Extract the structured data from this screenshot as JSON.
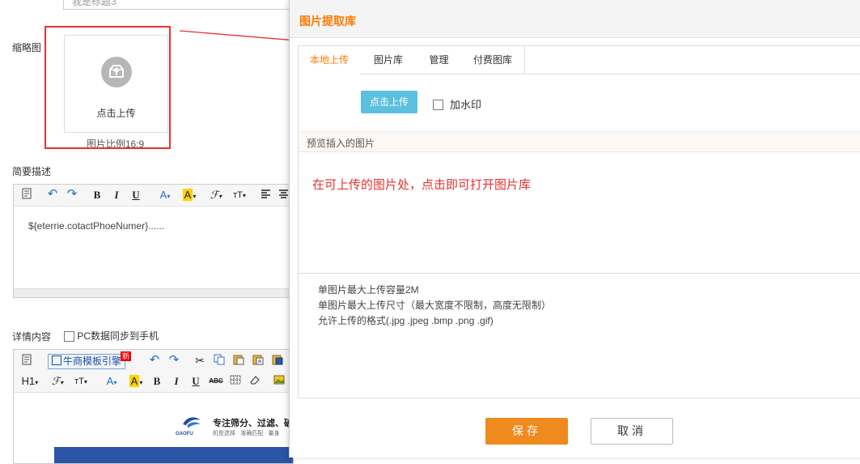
{
  "form": {
    "title_placeholder": "我是标题3",
    "thumbnail_label": "缩略图",
    "upload_text": "点击上传",
    "thumbnail_ratio": "图片比例16:9",
    "summary_label": "简要描述",
    "summary_text": "${eterrie.cotactPhoeNumer}......",
    "detail_label": "详情内容",
    "sync_label": "PC数据同步到手机",
    "template_button": "牛商模板引擎",
    "template_badge": "新",
    "heading_button": "H1",
    "banner_title": "专注筛分、过滤、破",
    "banner_sub": "机型选择 · 准确匹配 · 量身",
    "logo_text": "GAOFU"
  },
  "dialog": {
    "title": "图片提取库",
    "tabs": [
      "本地上传",
      "图片库",
      "管理",
      "付费图库"
    ],
    "active_tab": 0,
    "upload_button": "点击上传",
    "watermark_label": "加水印",
    "preview_header": "预览插入的图片",
    "annotation": "在可上传的图片处，点击即可打开图片库",
    "rules": [
      "单图片最大上传容量2M",
      "单图片最大上传尺寸（最大宽度不限制，高度无限制）",
      "允许上传的格式(.jpg .jpeg .bmp .png .gif)"
    ],
    "save_button": "保存",
    "cancel_button": "取消"
  },
  "colors": {
    "accent_orange": "#ff7a00",
    "save_orange": "#ef8a1e",
    "upload_blue": "#5bc0de",
    "annotation_red": "#e53333"
  }
}
